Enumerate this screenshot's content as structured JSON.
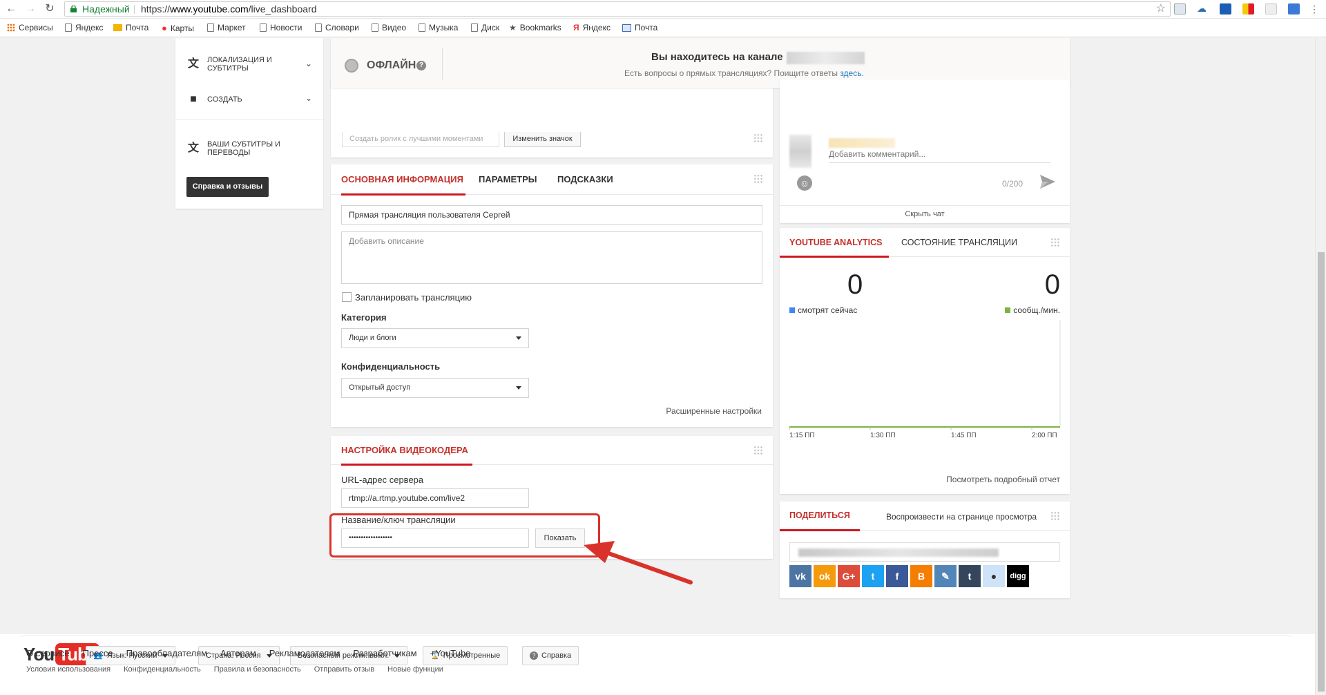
{
  "browser": {
    "secure_label": "Надежный",
    "url_scheme": "https://",
    "url_host": "www.youtube.com",
    "url_path": "/live_dashboard",
    "bookmarks": [
      "Сервисы",
      "Яндекс",
      "Почта",
      "Карты",
      "Маркет",
      "Новости",
      "Словари",
      "Видео",
      "Музыка",
      "Диск",
      "Bookmarks",
      "Яндекс",
      "Почта"
    ]
  },
  "sidebar": {
    "items": [
      {
        "label": "ЛОКАЛИЗАЦИЯ И СУБТИТРЫ",
        "icon": "translate-icon"
      },
      {
        "label": "СОЗДАТЬ",
        "icon": "camera-icon"
      },
      {
        "label": "ВАШИ СУБТИТРЫ И ПЕРЕВОДЫ",
        "icon": "translate-icon"
      }
    ],
    "help_button": "Справка и отзывы"
  },
  "status": {
    "state": "ОФЛАЙН",
    "channel_prefix": "Вы находитесь на канале",
    "faq_text": "Есть вопросы о прямых трансляциях? Поищите ответы",
    "faq_link": "здесь."
  },
  "highlights": {
    "placeholder": "Создать ролик с лучшими моментами",
    "change_icon": "Изменить значок"
  },
  "info": {
    "tabs": [
      "ОСНОВНАЯ ИНФОРМАЦИЯ",
      "ПАРАМЕТРЫ",
      "ПОДСКАЗКИ"
    ],
    "title_value": "Прямая трансляция пользователя Сергей",
    "description_placeholder": "Добавить описание",
    "schedule_label": "Запланировать трансляцию",
    "category_label": "Категория",
    "category_value": "Люди и блоги",
    "privacy_label": "Конфиденциальность",
    "privacy_value": "Открытый доступ",
    "advanced_link": "Расширенные настройки"
  },
  "encoder": {
    "tab": "НАСТРОЙКА ВИДЕОКОДЕРА",
    "server_label": "URL-адрес сервера",
    "server_value": "rtmp://a.rtmp.youtube.com/live2",
    "key_label": "Название/ключ трансляции",
    "key_value": "••••••••••••••••••",
    "show_button": "Показать"
  },
  "chat": {
    "comment_placeholder": "Добавить комментарий...",
    "char_count": "0/200",
    "hide_chat": "Скрыть чат"
  },
  "analytics": {
    "tabs": [
      "YOUTUBE ANALYTICS",
      "СОСТОЯНИЕ ТРАНСЛЯЦИИ"
    ],
    "viewers_value": "0",
    "viewers_label": "смотрят сейчас",
    "messages_value": "0",
    "messages_label": "сообщ./мин.",
    "viewers_color": "#4285f4",
    "messages_color": "#7cb342",
    "report_link": "Посмотреть подробный отчет"
  },
  "chart_data": {
    "type": "line",
    "x": [
      "1:15 ПП",
      "1:30 ПП",
      "1:45 ПП",
      "2:00 ПП"
    ],
    "series": [
      {
        "values": [
          0,
          0,
          0,
          0
        ]
      }
    ],
    "xlabel": "",
    "ylabel": ""
  },
  "share": {
    "tabs": [
      "ПОДЕЛИТЬСЯ",
      "Воспроизвести на странице просмотра"
    ],
    "networks": [
      {
        "name": "vk-icon",
        "glyph": "vk",
        "color": "#4c75a3"
      },
      {
        "name": "odnoklassniki-icon",
        "glyph": "ok",
        "color": "#f59a0b"
      },
      {
        "name": "google-plus-icon",
        "glyph": "G+",
        "color": "#dd4b39"
      },
      {
        "name": "twitter-icon",
        "glyph": "t",
        "color": "#1da1f2"
      },
      {
        "name": "facebook-icon",
        "glyph": "f",
        "color": "#3b5998"
      },
      {
        "name": "blogger-icon",
        "glyph": "B",
        "color": "#f57d00"
      },
      {
        "name": "livejournal-icon",
        "glyph": "✎",
        "color": "#5285b8"
      },
      {
        "name": "tumblr-icon",
        "glyph": "t",
        "color": "#35465c"
      },
      {
        "name": "reddit-icon",
        "glyph": "●",
        "color": "#cee3f8"
      },
      {
        "name": "digg-icon",
        "glyph": "digg",
        "color": "#000000"
      }
    ]
  },
  "footer": {
    "logo_you": "You",
    "logo_tube": "Tube",
    "buttons": [
      "Язык: Русский",
      "Страна: Россия",
      "Безопасный режим: выкл.",
      "Просмотренные",
      "Справка"
    ],
    "links_primary": [
      "О сервисе",
      "Прессе",
      "Правообладателям",
      "Авторам",
      "Рекламодателям",
      "Разработчикам",
      "+YouTube"
    ],
    "links_secondary": [
      "Условия использования",
      "Конфиденциальность",
      "Правила и безопасность",
      "Отправить отзыв",
      "Новые функции"
    ]
  }
}
